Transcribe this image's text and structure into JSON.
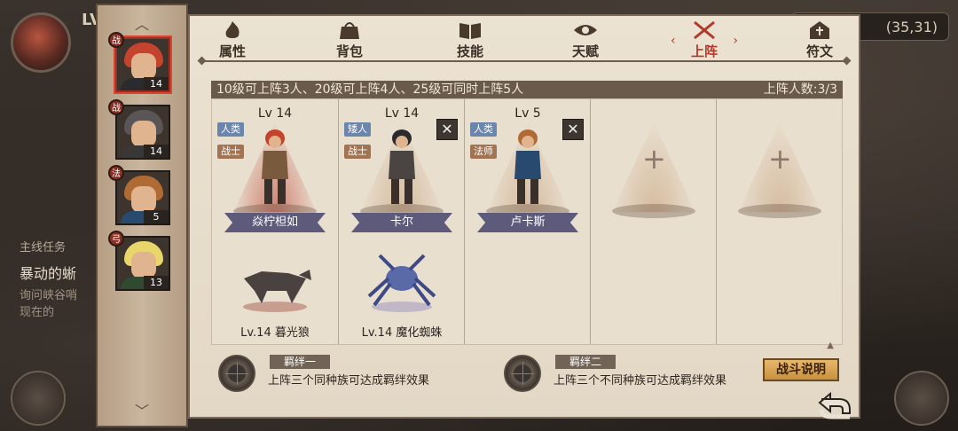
{
  "hud": {
    "level_prefix": "LV",
    "coords": "(35,31)",
    "quest": {
      "header": "主线任务",
      "title": "暴动的蜥",
      "line1": "询问峡谷哨",
      "line2": "现在的"
    }
  },
  "side_tabs": [
    {
      "level": "14",
      "badge": "战",
      "hair": "#c4432d",
      "body": "#2b2a2f",
      "selected": true
    },
    {
      "level": "14",
      "badge": "战",
      "hair": "#5a5658",
      "body": "#3a3836",
      "selected": false
    },
    {
      "level": "5",
      "badge": "法",
      "hair": "#b06a34",
      "body": "#274a6e",
      "selected": false
    },
    {
      "level": "13",
      "badge": "弓",
      "hair": "#e8d66a",
      "body": "#2f4a2e",
      "selected": false
    }
  ],
  "tabs": [
    {
      "label": "属性",
      "icon": "flame-icon"
    },
    {
      "label": "背包",
      "icon": "bag-icon"
    },
    {
      "label": "技能",
      "icon": "book-icon"
    },
    {
      "label": "天赋",
      "icon": "eye-icon"
    },
    {
      "label": "上阵",
      "icon": "crossed-swords-icon",
      "active": true
    },
    {
      "label": "符文",
      "icon": "rune-icon"
    }
  ],
  "info": {
    "text": "10级可上阵3人、20级可上阵4人、25级可同时上阵5人",
    "count_label": "上阵人数:3/3"
  },
  "slots": [
    {
      "lv": "Lv 14",
      "race": "人类",
      "job": "战士",
      "name": "焱柠柦如",
      "pet": "Lv.14 暮光狼",
      "removable": false,
      "accent": "red",
      "hero_hair": "#c4432d",
      "hero_body": "#7a5a3c"
    },
    {
      "lv": "Lv 14",
      "race": "矮人",
      "job": "战士",
      "name": "卡尔",
      "pet": "Lv.14 魔化蜘蛛",
      "removable": true,
      "accent": "plain",
      "hero_hair": "#2b2a2f",
      "hero_body": "#4a4542"
    },
    {
      "lv": "Lv 5",
      "race": "人类",
      "job": "法师",
      "name": "卢卡斯",
      "pet": "",
      "removable": true,
      "accent": "plain",
      "hero_hair": "#b06a34",
      "hero_body": "#274a6e"
    },
    {
      "empty": true
    },
    {
      "empty": true
    }
  ],
  "bonds": [
    {
      "title": "羁绊一",
      "desc": "上阵三个同种族可达成羁绊效果"
    },
    {
      "title": "羁绊二",
      "desc": "上阵三个不同种族可达成羁绊效果"
    }
  ],
  "battle_button": "战斗说明",
  "remove_glyph": "✕",
  "plus_glyph": "+",
  "arrow_up": "︿",
  "arrow_down": "﹀"
}
